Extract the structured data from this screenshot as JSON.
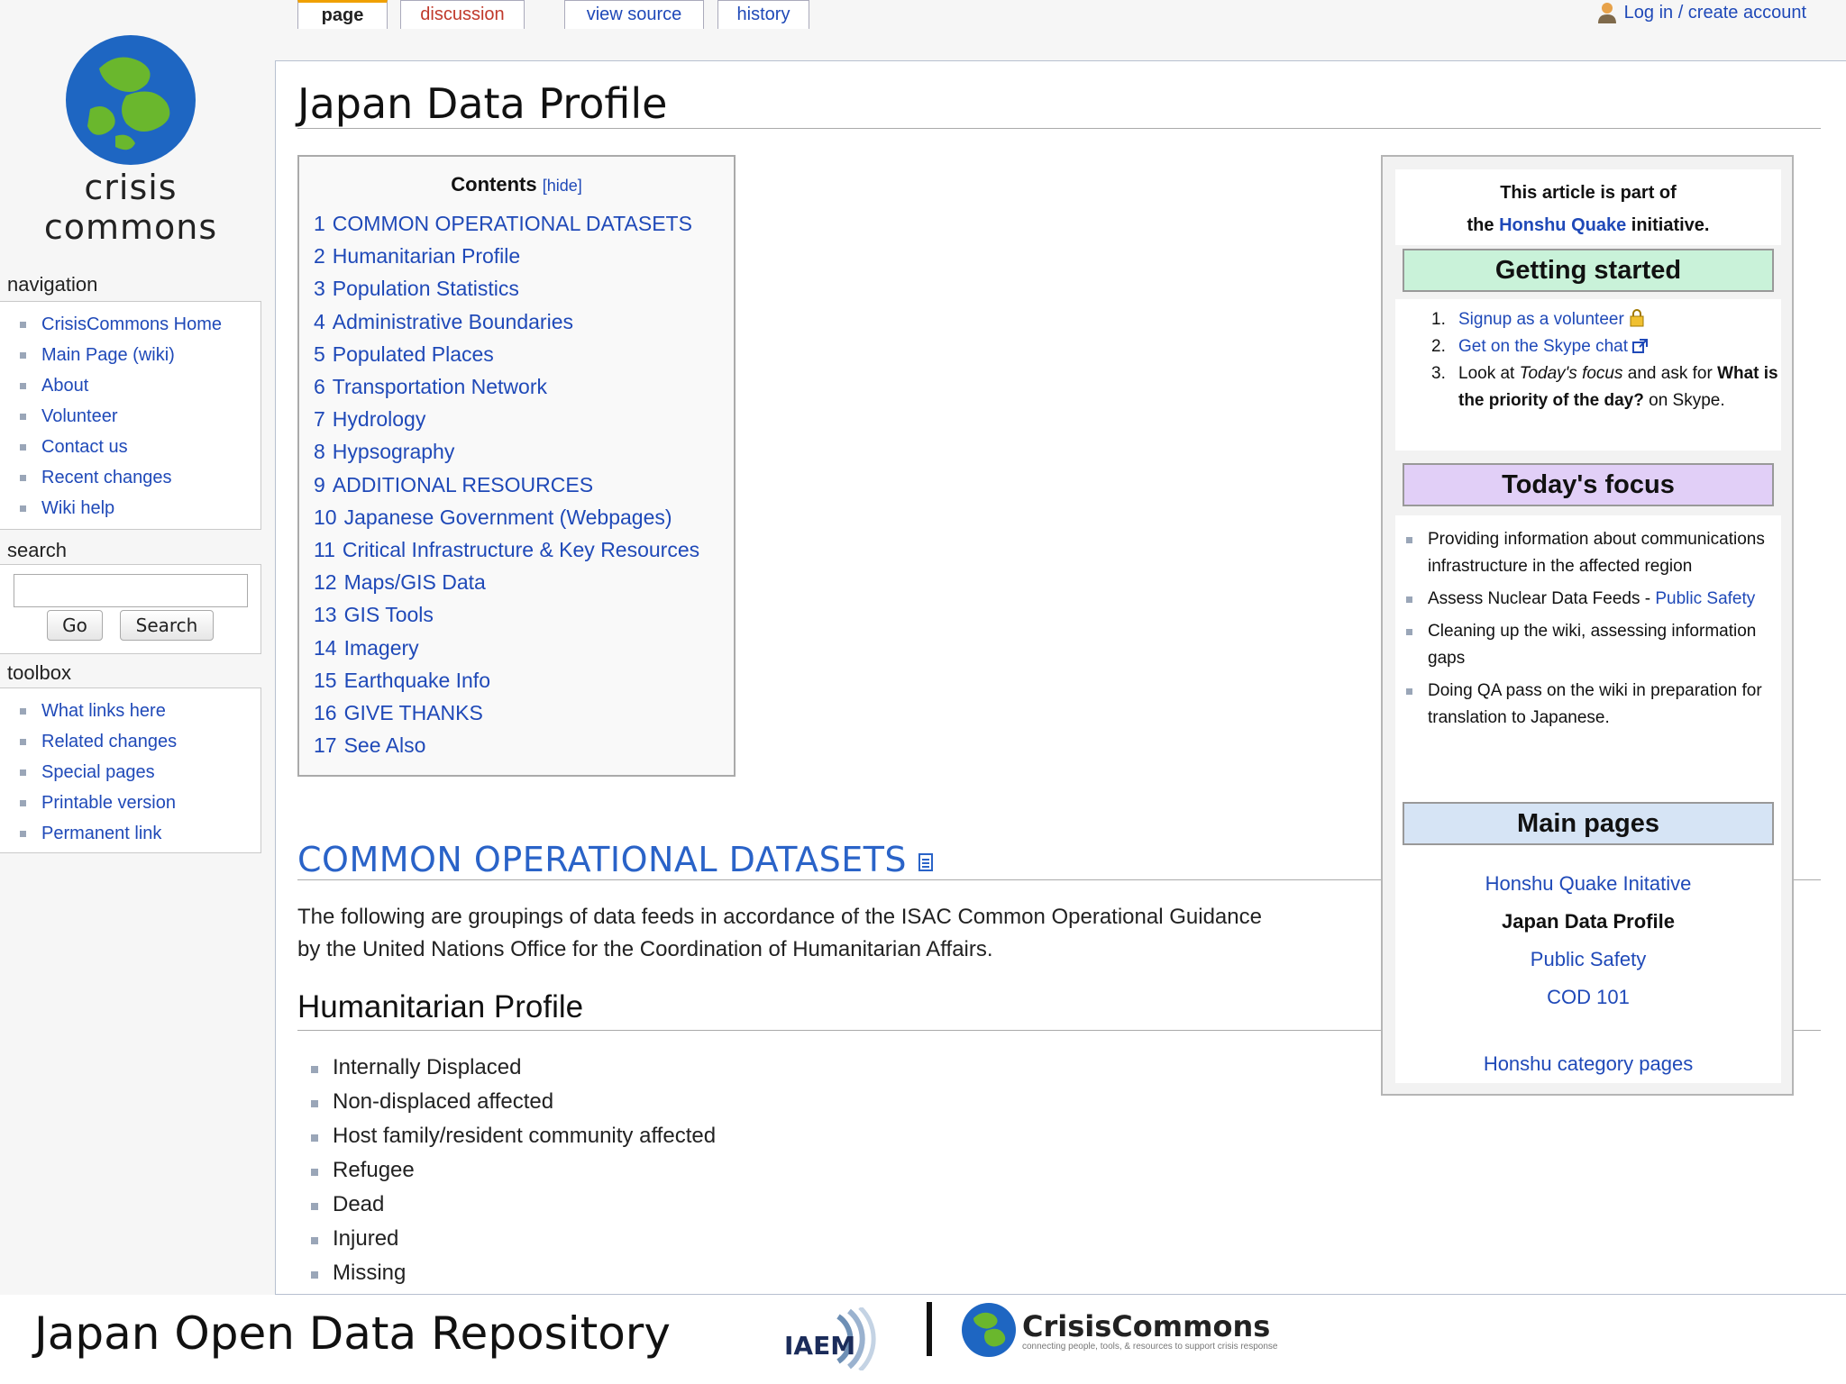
{
  "logo": {
    "line1": "crisis",
    "line2": "commons"
  },
  "header": {
    "login_link": "Log in / create account"
  },
  "tabs": [
    "page",
    "discussion",
    "view source",
    "history"
  ],
  "navigation": {
    "title": "navigation",
    "items": [
      "CrisisCommons Home",
      "Main Page (wiki)",
      "About",
      "Volunteer",
      "Contact us",
      "Recent changes",
      "Wiki help"
    ]
  },
  "search": {
    "title": "search",
    "go_label": "Go",
    "search_label": "Search",
    "value": ""
  },
  "toolbox": {
    "title": "toolbox",
    "items": [
      "What links here",
      "Related changes",
      "Special pages",
      "Printable version",
      "Permanent link"
    ]
  },
  "page": {
    "title": "Japan Data Profile",
    "toc_title": "Contents",
    "toc_hide": "[hide]",
    "toc": [
      {
        "num": "1",
        "label": "COMMON OPERATIONAL DATASETS"
      },
      {
        "num": "2",
        "label": "Humanitarian Profile"
      },
      {
        "num": "3",
        "label": "Population Statistics"
      },
      {
        "num": "4",
        "label": "Administrative Boundaries"
      },
      {
        "num": "5",
        "label": "Populated Places"
      },
      {
        "num": "6",
        "label": "Transportation Network"
      },
      {
        "num": "7",
        "label": "Hydrology"
      },
      {
        "num": "8",
        "label": "Hypsography"
      },
      {
        "num": "9",
        "label": "ADDITIONAL RESOURCES"
      },
      {
        "num": "10",
        "label": "Japanese Government (Webpages)"
      },
      {
        "num": "11",
        "label": "Critical Infrastructure & Key Resources"
      },
      {
        "num": "12",
        "label": "Maps/GIS Data"
      },
      {
        "num": "13",
        "label": "GIS Tools"
      },
      {
        "num": "14",
        "label": "Imagery"
      },
      {
        "num": "15",
        "label": "Earthquake Info"
      },
      {
        "num": "16",
        "label": "GIVE THANKS"
      },
      {
        "num": "17",
        "label": "See Also"
      }
    ],
    "section_heading": "COMMON OPERATIONAL DATASETS",
    "section_text_line1": "The following are groupings of data feeds in accordance of the ISAC Common Operational Guidance",
    "section_text_line2": "by the United Nations Office for the Coordination of Humanitarian Affairs.",
    "subheading": "Humanitarian Profile",
    "humanitarian_items": [
      "Internally Displaced",
      "Non-displaced affected",
      "Host family/resident community affected",
      "Refugee",
      "Dead",
      "Injured",
      "Missing"
    ]
  },
  "infobox": {
    "intro_line1": "This article is part of",
    "intro_pre": "the ",
    "intro_link": "Honshu Quake",
    "intro_post": " initiative.",
    "getting_started": "Getting started",
    "steps": {
      "s1": "Signup as a volunteer",
      "s2": "Get on the Skype chat",
      "s3_pre": "Look at ",
      "s3_em": "Today's focus",
      "s3_mid": " and ask for ",
      "s3_bold": "What is the priority of the day?",
      "s3_post": " on Skype."
    },
    "todays_focus": "Today's focus",
    "focus": {
      "f1": "Providing information about communications infrastructure in the affected region",
      "f2_pre": "Assess Nuclear Data Feeds - ",
      "f2_link": "Public Safety",
      "f3": "Cleaning up the wiki, assessing information gaps",
      "f4": "Doing QA pass on the wiki in preparation for translation to Japanese."
    },
    "main_pages": "Main pages",
    "pages": [
      "Honshu Quake Initative",
      "Japan Data Profile",
      "Public Safety",
      "COD 101"
    ],
    "category": "Honshu category pages"
  },
  "footer": {
    "title": "Japan Open Data Repository",
    "iaem": "IAEM",
    "cc_name": "CrisisCommons",
    "cc_tagline": "connecting people, tools, & resources to support crisis response"
  },
  "colors": {
    "link": "#1f49b8",
    "getting_started_bg": "#c9f2d9",
    "todays_focus_bg": "#e1cff7",
    "main_pages_bg": "#d6e4f5",
    "heading_blue": "#2a63c8"
  }
}
